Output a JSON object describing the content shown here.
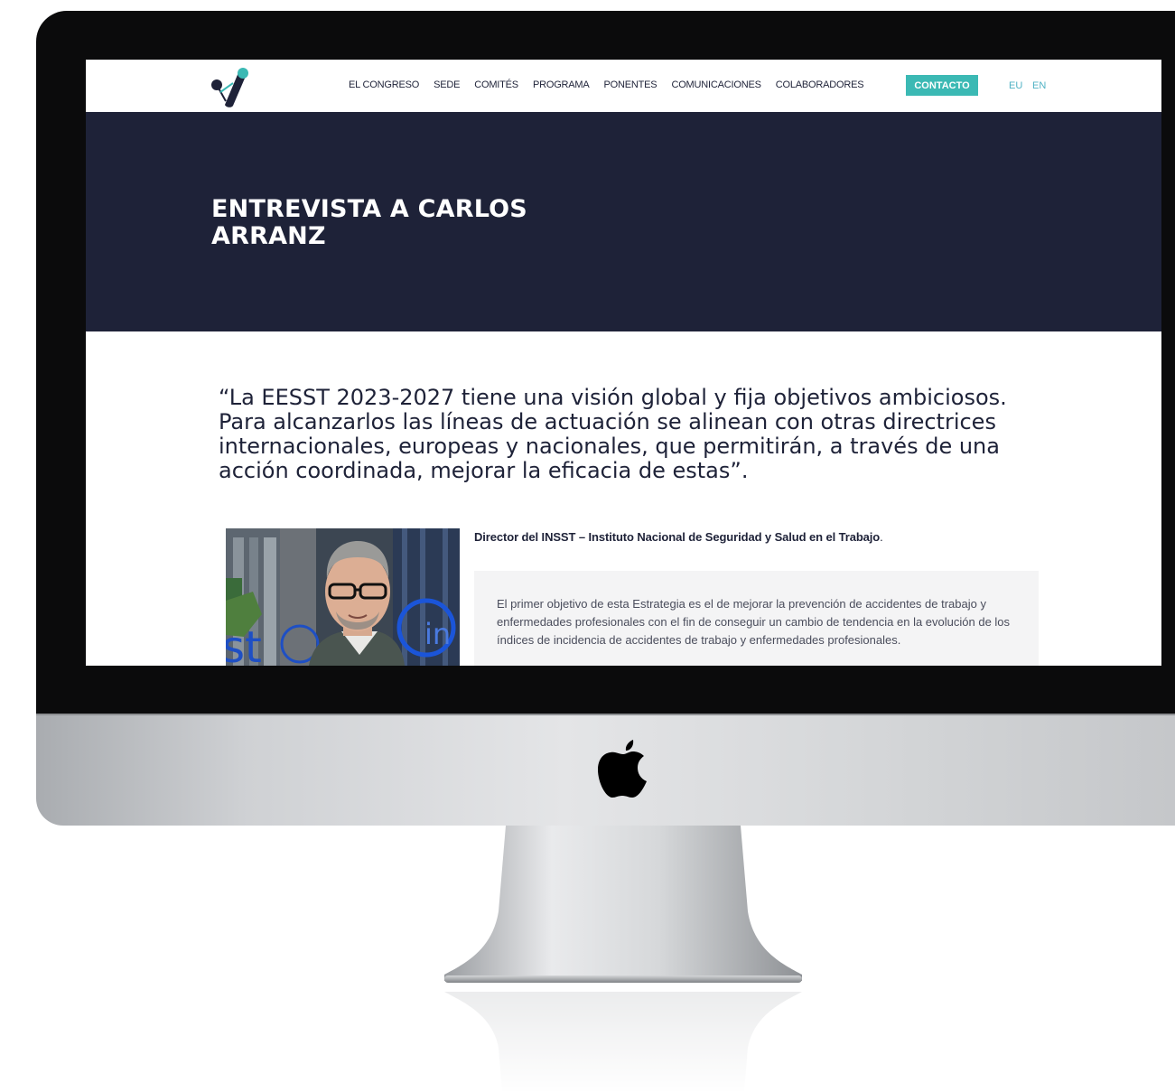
{
  "nav": {
    "items": [
      "EL CONGRESO",
      "SEDE",
      "COMITÉS",
      "PROGRAMA",
      "PONENTES",
      "COMUNICACIONES",
      "COLABORADORES"
    ],
    "cta": "CONTACTO",
    "lang": [
      "EU",
      "EN"
    ]
  },
  "hero": {
    "title": "ENTREVISTA A CARLOS ARRANZ"
  },
  "article": {
    "quote": "“La EESST 2023-2027 tiene una visión global y fija objetivos ambiciosos. Para alcanzarlos las líneas de actuación se alinean con otras directrices internacionales, europeas y nacionales, que permitirán, a través de una acción coordinada, mejorar la eficacia de estas”.",
    "role": "Director del INSST – Instituto Nacional de Seguridad y Salud en el Trabajo",
    "role_end": ".",
    "body": "El primer objetivo de esta Estrategia es el de mejorar la prevención de accidentes de trabajo y enfermedades profesionales con el fin de conseguir un cambio de tendencia en la evolución de los índices de incidencia de accidentes de trabajo y enfermedades profesionales."
  },
  "colors": {
    "navy": "#1e2238",
    "teal": "#3bb9b4",
    "lang": "#4fb2c4"
  },
  "icons": {
    "logo": "congress-logo",
    "device": "apple-logo"
  }
}
